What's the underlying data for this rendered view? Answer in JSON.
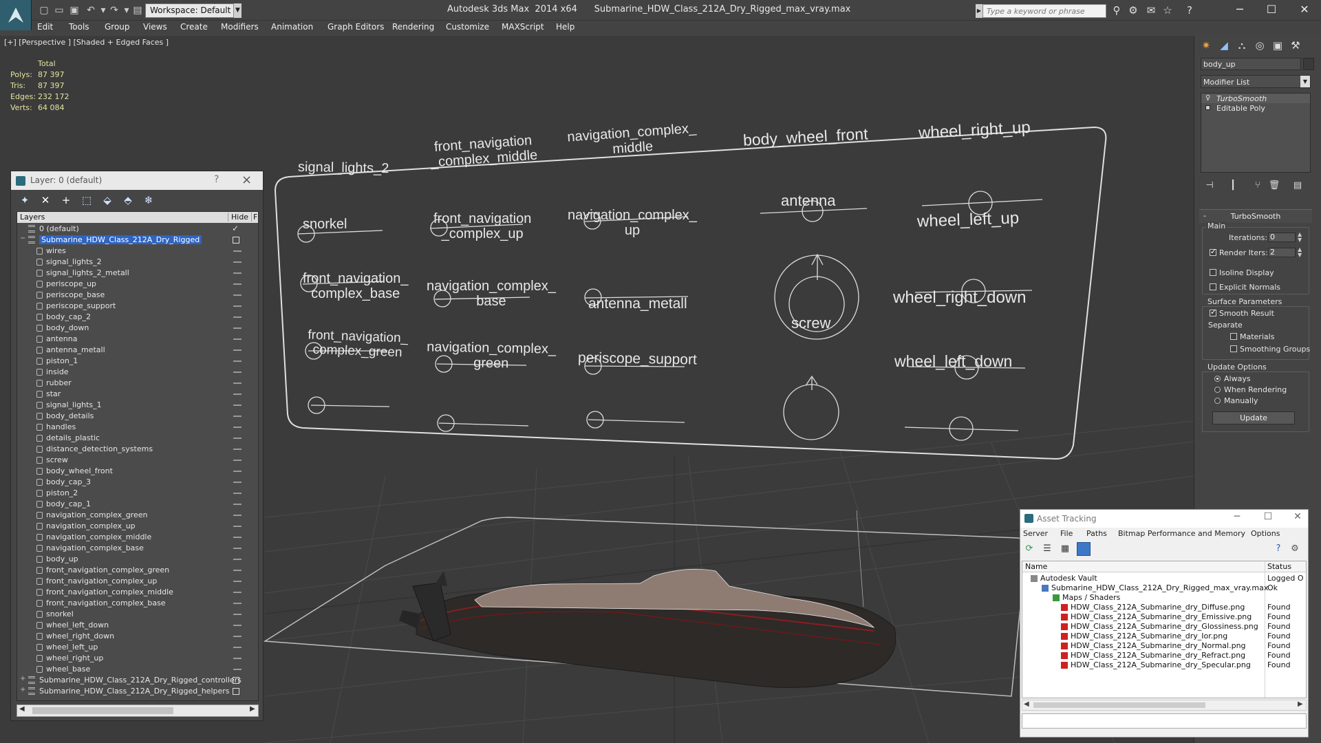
{
  "app": {
    "title": "Autodesk 3ds Max  2014 x64      Submarine_HDW_Class_212A_Dry_Rigged_max_vray.max",
    "workspace": "Workspace: Default",
    "search_placeholder": "Type a keyword or phrase"
  },
  "menu": [
    "Edit",
    "Tools",
    "Group",
    "Views",
    "Create",
    "Modifiers",
    "Animation",
    "Graph Editors",
    "Rendering",
    "Customize",
    "MAXScript",
    "Help"
  ],
  "viewport": {
    "label": "[+] [Perspective ] [Shaded + Edged Faces ]",
    "stats_header": "Total",
    "stats": [
      {
        "k": "Polys:",
        "v": "87 397"
      },
      {
        "k": "Tris:",
        "v": "87 397"
      },
      {
        "k": "Edges:",
        "v": "232 172"
      },
      {
        "k": "Verts:",
        "v": "64 084"
      }
    ],
    "rig_labels": [
      "signal_lights_2",
      "front_navigation\n_complex_middle",
      "navigation_complex_\nmiddle",
      "body_wheel_front",
      "wheel_right_up",
      "snorkel",
      "front_navigation\n_complex_up",
      "navigation_complex_\nup",
      "antenna",
      "wheel_left_up",
      "front_navigation_\ncomplex_base",
      "navigation_complex_\nbase",
      "antenna_metall",
      "wheel_right_down",
      "front_navigation_\ncomplex_green",
      "navigation_complex_\ngreen",
      "periscope_support",
      "screw",
      "wheel_left_down"
    ]
  },
  "layer_panel": {
    "title": "Layer: 0 (default)",
    "help": "?",
    "col_layers": "Layers",
    "col_hide": "Hide",
    "col_f": "F",
    "rows": [
      "0 (default)",
      "Submarine_HDW_Class_212A_Dry_Rigged",
      "wires",
      "signal_lights_2",
      "signal_lights_2_metall",
      "periscope_up",
      "periscope_base",
      "periscope_support",
      "body_cap_2",
      "body_down",
      "antenna",
      "antenna_metall",
      "piston_1",
      "inside",
      "rubber",
      "star",
      "signal_lights_1",
      "body_details",
      "handles",
      "details_plastic",
      "distance_detection_systems",
      "screw",
      "body_wheel_front",
      "body_cap_3",
      "piston_2",
      "body_cap_1",
      "navigation_complex_green",
      "navigation_complex_up",
      "navigation_complex_middle",
      "navigation_complex_base",
      "body_up",
      "front_navigation_complex_green",
      "front_navigation_complex_up",
      "front_navigation_complex_middle",
      "front_navigation_complex_base",
      "snorkel",
      "wheel_left_down",
      "wheel_right_down",
      "wheel_left_up",
      "wheel_right_up",
      "wheel_base",
      "Submarine_HDW_Class_212A_Dry_Rigged_controllers",
      "Submarine_HDW_Class_212A_Dry_Rigged_helpers"
    ]
  },
  "command_panel": {
    "object_name": "body_up",
    "modifier_list": "Modifier List",
    "stack": [
      "TurboSmooth",
      "Editable Poly"
    ],
    "rollout_title": "TurboSmooth",
    "main_label": "Main",
    "iterations_label": "Iterations:",
    "iterations_value": "0",
    "render_iters_label": "Render Iters:",
    "render_iters_value": "2",
    "isoline": "Isoline Display",
    "explicit_normals": "Explicit Normals",
    "surface_params": "Surface Parameters",
    "smooth_result": "Smooth Result",
    "separate": "Separate",
    "materials": "Materials",
    "smoothing_groups": "Smoothing Groups",
    "update_options": "Update Options",
    "always": "Always",
    "when_rendering": "When Rendering",
    "manually": "Manually",
    "update_btn": "Update"
  },
  "asset_tracking": {
    "title": "Asset Tracking",
    "menu": [
      "Server",
      "File",
      "Paths",
      "Bitmap Performance and Memory",
      "Options"
    ],
    "col_name": "Name",
    "col_status": "Status",
    "rows": [
      {
        "name": "Autodesk Vault",
        "status": "Logged O"
      },
      {
        "name": "Submarine_HDW_Class_212A_Dry_Rigged_max_vray.max",
        "status": "Ok"
      },
      {
        "name": "Maps / Shaders",
        "status": ""
      },
      {
        "name": "HDW_Class_212A_Submarine_dry_Diffuse.png",
        "status": "Found"
      },
      {
        "name": "HDW_Class_212A_Submarine_dry_Emissive.png",
        "status": "Found"
      },
      {
        "name": "HDW_Class_212A_Submarine_dry_Glossiness.png",
        "status": "Found"
      },
      {
        "name": "HDW_Class_212A_Submarine_dry_Ior.png",
        "status": "Found"
      },
      {
        "name": "HDW_Class_212A_Submarine_dry_Normal.png",
        "status": "Found"
      },
      {
        "name": "HDW_Class_212A_Submarine_dry_Refract.png",
        "status": "Found"
      },
      {
        "name": "HDW_Class_212A_Submarine_dry_Specular.png",
        "status": "Found"
      }
    ]
  }
}
